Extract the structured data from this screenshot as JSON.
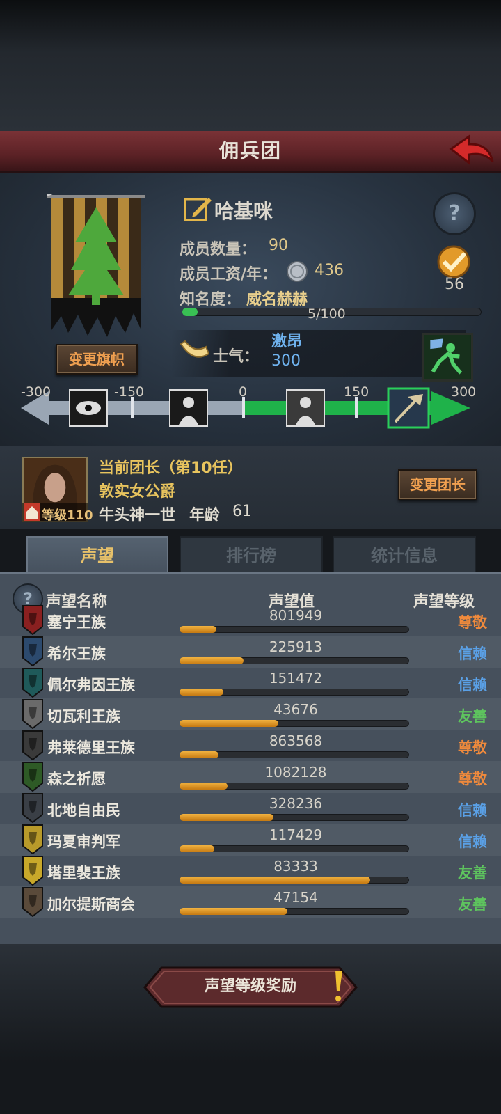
{
  "header": {
    "title": "佣兵团"
  },
  "guild": {
    "name": "哈基咪",
    "members_label": "成员数量：",
    "members_value": "90",
    "salary_label": "成员工资/年：",
    "salary_value": "436",
    "fame_label": "知名度：",
    "fame_value": "威名赫赫",
    "fame_progress_text": "5/100",
    "fame_progress": 0.05,
    "reward_count": "56",
    "change_banner_label": "变更旗帜"
  },
  "morale": {
    "label": "士气：",
    "state": "激昂",
    "value": "300",
    "scale_ticks": [
      "-300",
      "-150",
      "0",
      "150",
      "300"
    ]
  },
  "leader": {
    "title": "当前团长（第10任）",
    "name": "敦实女公爵",
    "race": "牛头神一世",
    "age_label": "年龄",
    "age": "61",
    "level": "等级110",
    "change_label": "变更团长"
  },
  "tabs": [
    {
      "label": "声望",
      "active": true
    },
    {
      "label": "排行榜",
      "active": false
    },
    {
      "label": "统计信息",
      "active": false
    }
  ],
  "reputation": {
    "headers": {
      "name": "声望名称",
      "value": "声望值",
      "level": "声望等级"
    },
    "rows": [
      {
        "name": "塞宁王族",
        "value": "801949",
        "progress": 0.16,
        "level": "尊敬",
        "level_color": "#f08a3c",
        "icon_color": "#8a2020"
      },
      {
        "name": "希尔王族",
        "value": "225913",
        "progress": 0.28,
        "level": "信赖",
        "level_color": "#5aa0e6",
        "icon_color": "#2c4a6e"
      },
      {
        "name": "佩尔弗因王族",
        "value": "151472",
        "progress": 0.19,
        "level": "信赖",
        "level_color": "#5aa0e6",
        "icon_color": "#1f5a5a"
      },
      {
        "name": "切瓦利王族",
        "value": "43676",
        "progress": 0.43,
        "level": "友善",
        "level_color": "#5ec45e",
        "icon_color": "#6a6a6a"
      },
      {
        "name": "弗莱德里王族",
        "value": "863568",
        "progress": 0.17,
        "level": "尊敬",
        "level_color": "#f08a3c",
        "icon_color": "#3a3a3a"
      },
      {
        "name": "森之祈愿",
        "value": "1082128",
        "progress": 0.21,
        "level": "尊敬",
        "level_color": "#f08a3c",
        "icon_color": "#2e5a26"
      },
      {
        "name": "北地自由民",
        "value": "328236",
        "progress": 0.41,
        "level": "信赖",
        "level_color": "#5aa0e6",
        "icon_color": "#3a3f46"
      },
      {
        "name": "玛夏审判军",
        "value": "117429",
        "progress": 0.15,
        "level": "信赖",
        "level_color": "#5aa0e6",
        "icon_color": "#b89a2a"
      },
      {
        "name": "塔里裴王族",
        "value": "83333",
        "progress": 0.83,
        "level": "友善",
        "level_color": "#5ec45e",
        "icon_color": "#c8a82a"
      },
      {
        "name": "加尔提斯商会",
        "value": "47154",
        "progress": 0.47,
        "level": "友善",
        "level_color": "#5ec45e",
        "icon_color": "#5a4a3a"
      }
    ]
  },
  "footer": {
    "reward_button_label": "声望等级奖励"
  }
}
